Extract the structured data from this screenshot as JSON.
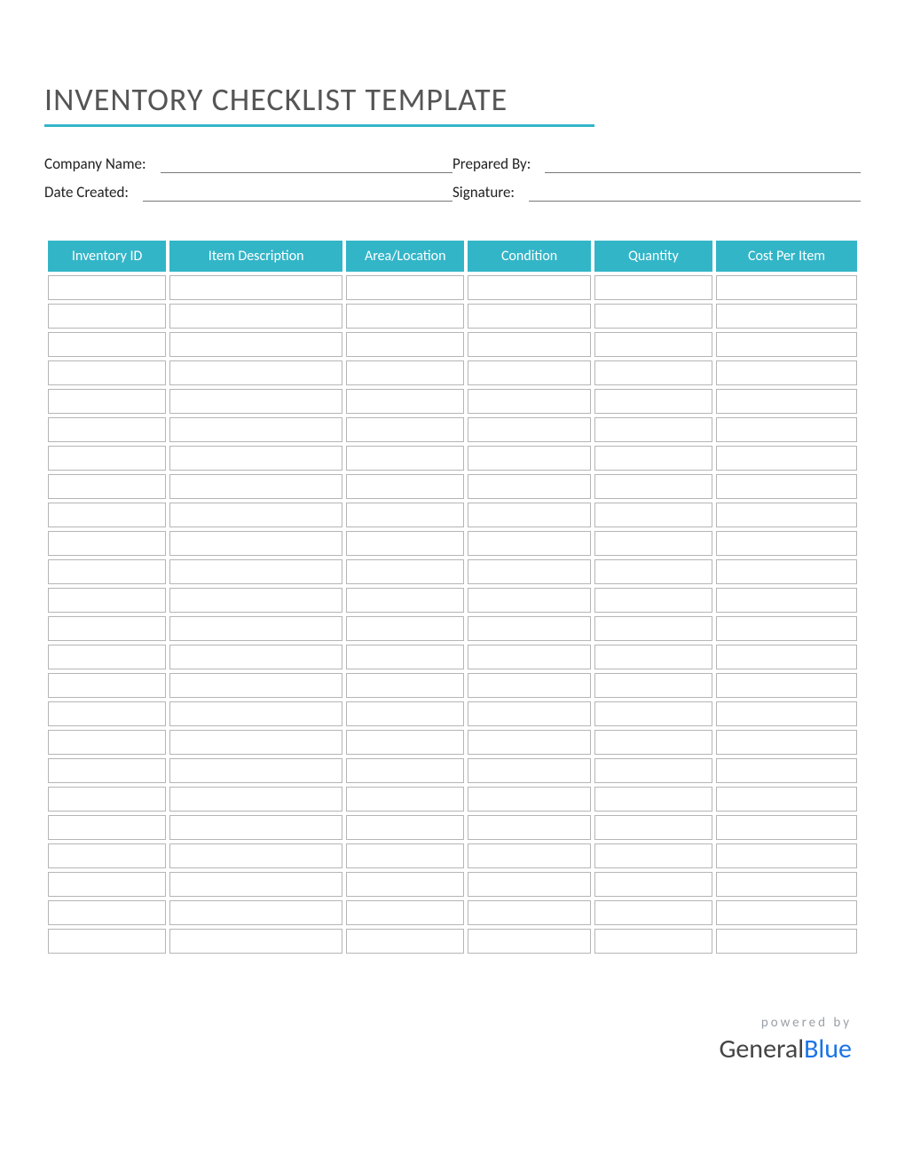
{
  "title": "INVENTORY CHECKLIST TEMPLATE",
  "meta": {
    "company_label": "Company Name:",
    "prepared_label": "Prepared By:",
    "date_label": "Date Created:",
    "signature_label": "Signature:",
    "company_value": "",
    "prepared_value": "",
    "date_value": "",
    "signature_value": ""
  },
  "columns": [
    "Inventory ID",
    "Item Description",
    "Area/Location",
    "Condition",
    "Quantity",
    "Cost Per Item"
  ],
  "rows": [
    [
      "",
      "",
      "",
      "",
      "",
      ""
    ],
    [
      "",
      "",
      "",
      "",
      "",
      ""
    ],
    [
      "",
      "",
      "",
      "",
      "",
      ""
    ],
    [
      "",
      "",
      "",
      "",
      "",
      ""
    ],
    [
      "",
      "",
      "",
      "",
      "",
      ""
    ],
    [
      "",
      "",
      "",
      "",
      "",
      ""
    ],
    [
      "",
      "",
      "",
      "",
      "",
      ""
    ],
    [
      "",
      "",
      "",
      "",
      "",
      ""
    ],
    [
      "",
      "",
      "",
      "",
      "",
      ""
    ],
    [
      "",
      "",
      "",
      "",
      "",
      ""
    ],
    [
      "",
      "",
      "",
      "",
      "",
      ""
    ],
    [
      "",
      "",
      "",
      "",
      "",
      ""
    ],
    [
      "",
      "",
      "",
      "",
      "",
      ""
    ],
    [
      "",
      "",
      "",
      "",
      "",
      ""
    ],
    [
      "",
      "",
      "",
      "",
      "",
      ""
    ],
    [
      "",
      "",
      "",
      "",
      "",
      ""
    ],
    [
      "",
      "",
      "",
      "",
      "",
      ""
    ],
    [
      "",
      "",
      "",
      "",
      "",
      ""
    ],
    [
      "",
      "",
      "",
      "",
      "",
      ""
    ],
    [
      "",
      "",
      "",
      "",
      "",
      ""
    ],
    [
      "",
      "",
      "",
      "",
      "",
      ""
    ],
    [
      "",
      "",
      "",
      "",
      "",
      ""
    ],
    [
      "",
      "",
      "",
      "",
      "",
      ""
    ],
    [
      "",
      "",
      "",
      "",
      "",
      ""
    ]
  ],
  "footer": {
    "powered": "powered by",
    "brand1": "General",
    "brand2": "Blue"
  },
  "colors": {
    "accent": "#33b5c8",
    "brand_blue": "#1a73e8"
  }
}
